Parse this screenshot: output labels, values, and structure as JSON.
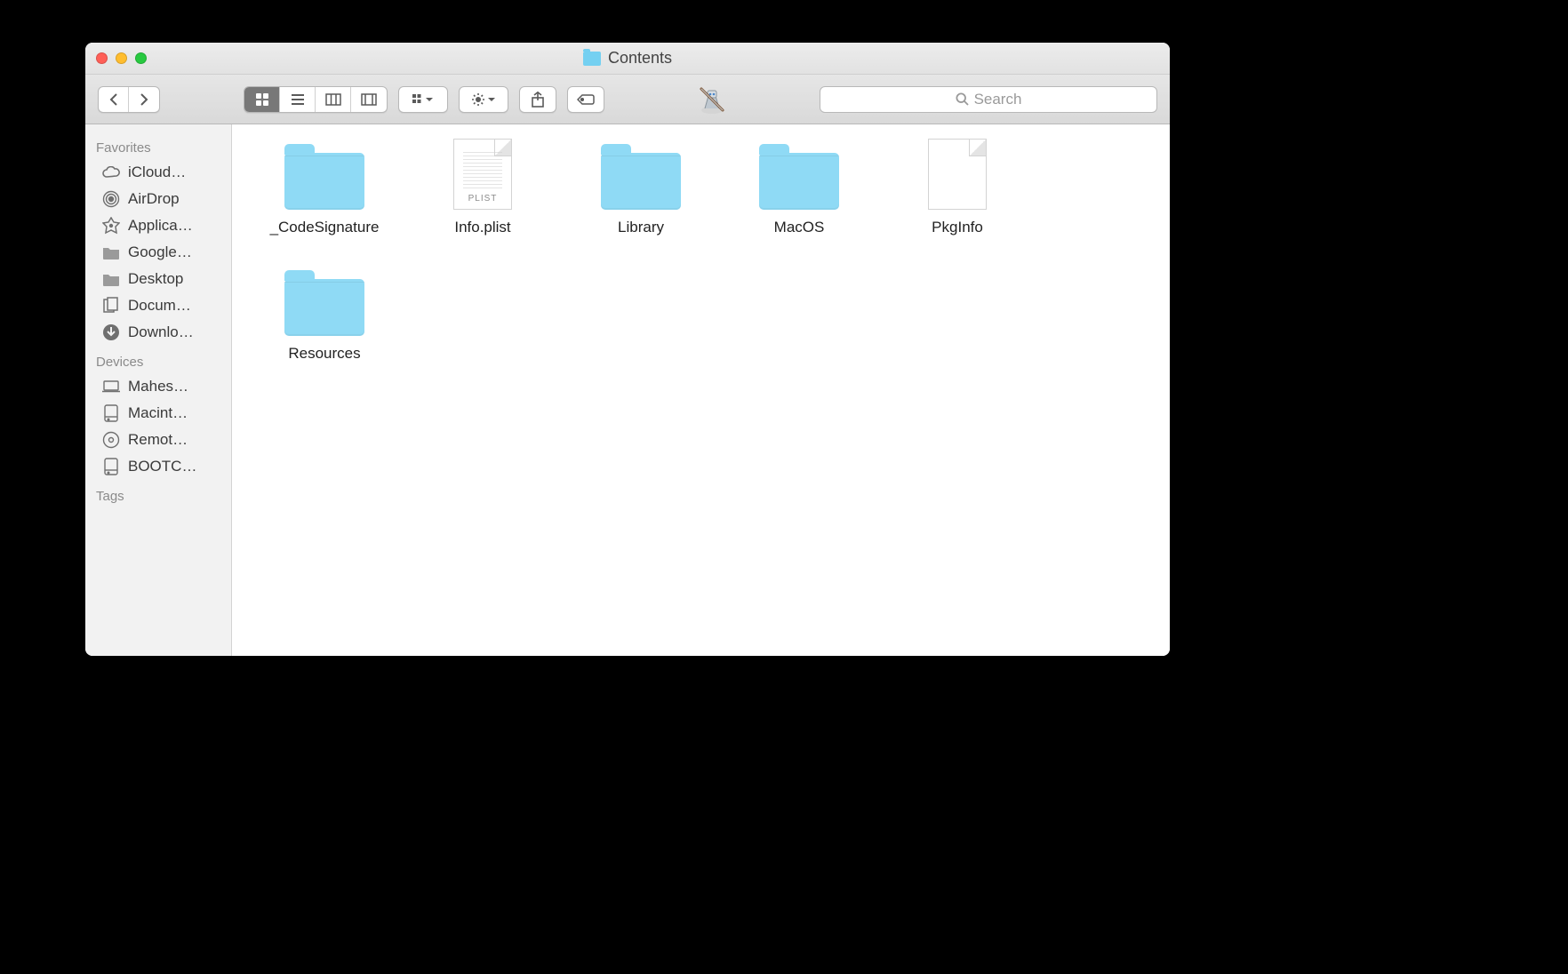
{
  "window": {
    "title": "Contents"
  },
  "search": {
    "placeholder": "Search"
  },
  "sidebar": {
    "sections": [
      {
        "header": "Favorites",
        "items": [
          {
            "icon": "cloud",
            "label": "iCloud…"
          },
          {
            "icon": "airdrop",
            "label": "AirDrop"
          },
          {
            "icon": "apps",
            "label": "Applica…"
          },
          {
            "icon": "folder",
            "label": "Google…"
          },
          {
            "icon": "desktop",
            "label": "Desktop"
          },
          {
            "icon": "doc",
            "label": "Docum…"
          },
          {
            "icon": "download",
            "label": "Downlo…"
          }
        ]
      },
      {
        "header": "Devices",
        "items": [
          {
            "icon": "laptop",
            "label": "Mahes…"
          },
          {
            "icon": "hdd",
            "label": "Macint…"
          },
          {
            "icon": "disc",
            "label": "Remot…"
          },
          {
            "icon": "hdd",
            "label": "BOOTC…"
          }
        ]
      },
      {
        "header": "Tags",
        "items": []
      }
    ]
  },
  "items": [
    {
      "type": "folder",
      "name": "_CodeSignature"
    },
    {
      "type": "plist",
      "name": "Info.plist",
      "badge": "PLIST"
    },
    {
      "type": "folder",
      "name": "Library"
    },
    {
      "type": "folder",
      "name": "MacOS"
    },
    {
      "type": "file",
      "name": "PkgInfo"
    },
    {
      "type": "folder",
      "name": "Resources"
    }
  ]
}
